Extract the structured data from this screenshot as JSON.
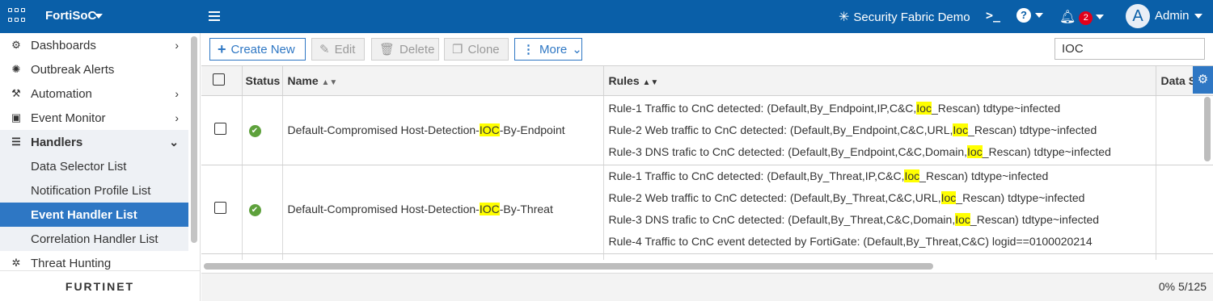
{
  "header": {
    "product": "FortiSoC",
    "fabric": "Security Fabric Demo",
    "notifications": "2",
    "avatar_letter": "A",
    "user": "Admin"
  },
  "sidebar": {
    "items": [
      {
        "label": "Dashboards",
        "icon": "dashboard-icon"
      },
      {
        "label": "Outbreak Alerts",
        "icon": "bug-icon"
      },
      {
        "label": "Automation",
        "icon": "robot-arm-icon"
      },
      {
        "label": "Event Monitor",
        "icon": "monitor-icon"
      },
      {
        "label": "Handlers",
        "icon": "list-icon"
      },
      {
        "label": "Data Selector List"
      },
      {
        "label": "Notification Profile List"
      },
      {
        "label": "Event Handler List"
      },
      {
        "label": "Correlation Handler List"
      },
      {
        "label": "Threat Hunting",
        "icon": "spider-icon"
      }
    ],
    "logo": "FURTINET"
  },
  "toolbar": {
    "create_new": "Create New",
    "edit": "Edit",
    "delete": "Delete",
    "clone": "Clone",
    "more": "More",
    "search_value": "IOC"
  },
  "table": {
    "columns": {
      "status": "Status",
      "name": "Name",
      "rules": "Rules",
      "data": "Data S"
    },
    "rows": [
      {
        "name_pre": "Default-Compromised Host-Detection-",
        "name_hl": "IOC",
        "name_post": "-By-Endpoint",
        "rules": [
          {
            "pre": "Rule-1 Traffic to CnC detected: (Default,By_Endpoint,IP,C&C,",
            "hl": "Ioc",
            "post": "_Rescan) tdtype~infected"
          },
          {
            "pre": "Rule-2 Web traffic to CnC detected: (Default,By_Endpoint,C&C,URL,",
            "hl": "Ioc",
            "post": "_Rescan) tdtype~infected"
          },
          {
            "pre": "Rule-3 DNS trafic to CnC detected: (Default,By_Endpoint,C&C,Domain,",
            "hl": "Ioc",
            "post": "_Rescan) tdtype~infected"
          }
        ]
      },
      {
        "name_pre": "Default-Compromised Host-Detection-",
        "name_hl": "IOC",
        "name_post": "-By-Threat",
        "rules": [
          {
            "pre": "Rule-1 Traffic to CnC detected: (Default,By_Threat,IP,C&C,",
            "hl": "Ioc",
            "post": "_Rescan) tdtype~infected"
          },
          {
            "pre": "Rule-2 Web traffic to CnC detected: (Default,By_Threat,C&C,URL,",
            "hl": "Ioc",
            "post": "_Rescan) tdtype~infected"
          },
          {
            "pre": "Rule-3 DNS trafic to CnC detected: (Default,By_Threat,C&C,Domain,",
            "hl": "Ioc",
            "post": "_Rescan) tdtype~infected"
          },
          {
            "pre": "Rule-4 Traffic to CnC event detected by FortiGate: (Default,By_Threat,C&C) logid==0100020214",
            "hl": "",
            "post": ""
          }
        ]
      }
    ]
  },
  "footer": {
    "progress": "0%",
    "count": "5/125"
  },
  "colors": {
    "header_bg": "#0a5fa8",
    "active_nav": "#2e77c4",
    "highlight": "#ffff00",
    "status_ok": "#5ea13c"
  }
}
